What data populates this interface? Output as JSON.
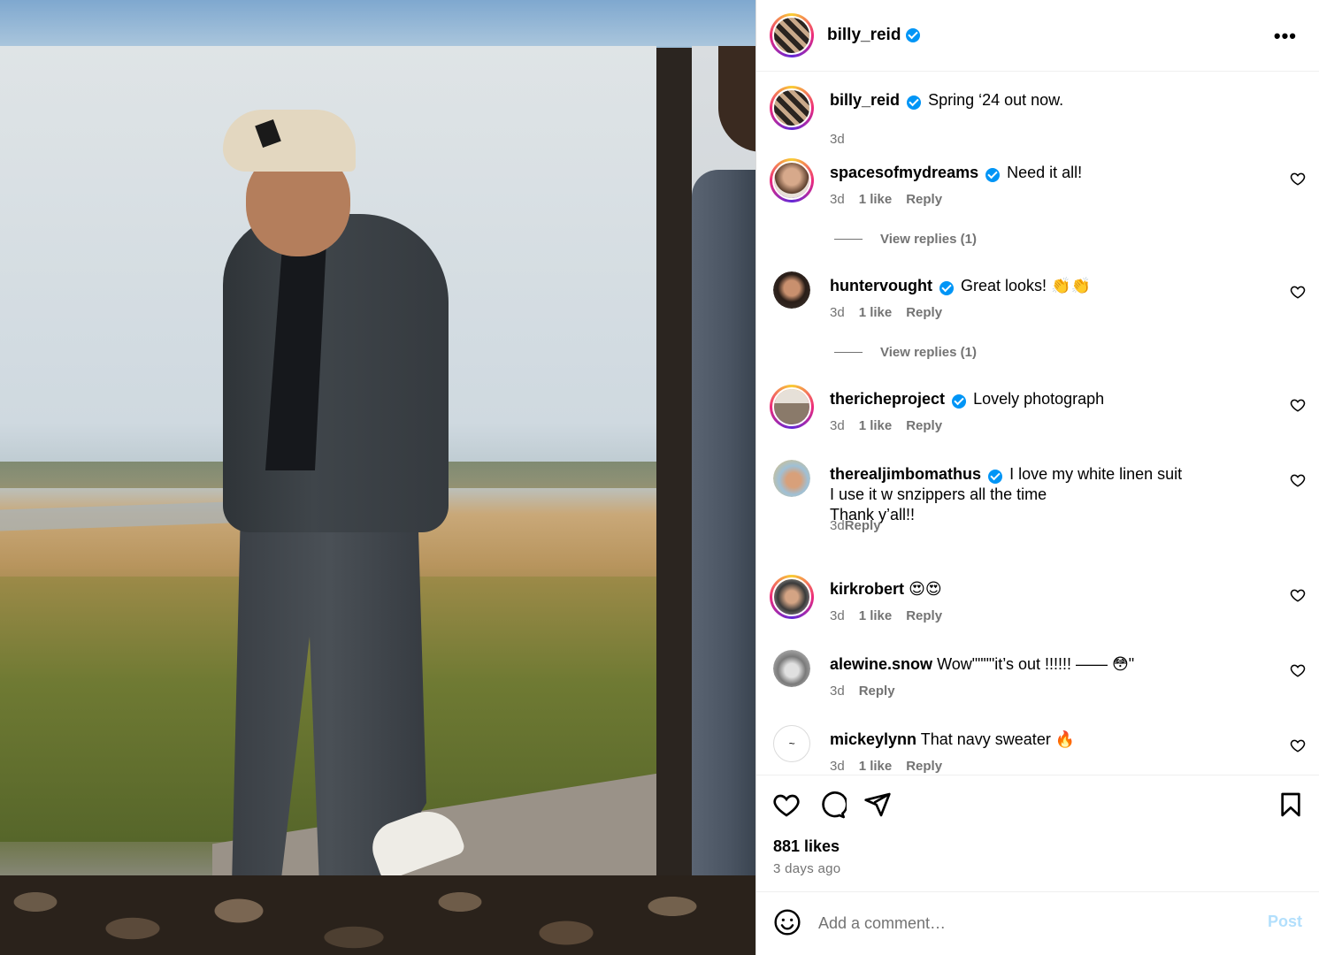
{
  "post": {
    "author": "billy_reid",
    "caption": "Spring ‘24 out now.",
    "caption_time": "3d"
  },
  "header": {
    "username": "billy_reid",
    "more_label": "•••"
  },
  "comments": [
    {
      "user": "spacesofmydreams",
      "text": "Need it all!",
      "time": "3d",
      "likes": "1 like",
      "reply": "Reply",
      "view_replies": "View replies (1)"
    },
    {
      "user": "huntervought",
      "text": "Great looks! 👏👏",
      "time": "3d",
      "likes": "1 like",
      "reply": "Reply",
      "view_replies": "View replies (1)"
    },
    {
      "user": "thericheproject",
      "text": "Lovely photograph",
      "time": "3d",
      "likes": "1 like",
      "reply": "Reply"
    },
    {
      "user": "therealjimbomathus",
      "text_line1": "I love my white linen suit",
      "text_line2": "I use it w snzippers all the time",
      "text_line3": "Thank y’all!!",
      "time": "3d",
      "reply": "Reply"
    },
    {
      "user": "kirkrobert",
      "text": "😍😍",
      "time": "3d",
      "likes": "1 like",
      "reply": "Reply"
    },
    {
      "user": "alewine.snow",
      "text": "Wow\"\"\"\"it’s out !!!!!! —— 😳\"",
      "time": "3d",
      "reply": "Reply"
    },
    {
      "user": "mickeylynn",
      "text": "That navy sweater 🔥",
      "time": "3d",
      "likes": "1 like",
      "reply": "Reply"
    }
  ],
  "footer": {
    "likes": "881 likes",
    "ago": "3 days ago",
    "comment_placeholder": "Add a comment…",
    "post_label": "Post"
  },
  "colors": {
    "verified": "#0095f6",
    "muted": "#737373",
    "post_disabled": "#b2dffc"
  },
  "icons": [
    "more-icon",
    "verified-badge-icon",
    "heart-icon",
    "comment-icon",
    "share-icon",
    "bookmark-icon",
    "smile-icon"
  ]
}
